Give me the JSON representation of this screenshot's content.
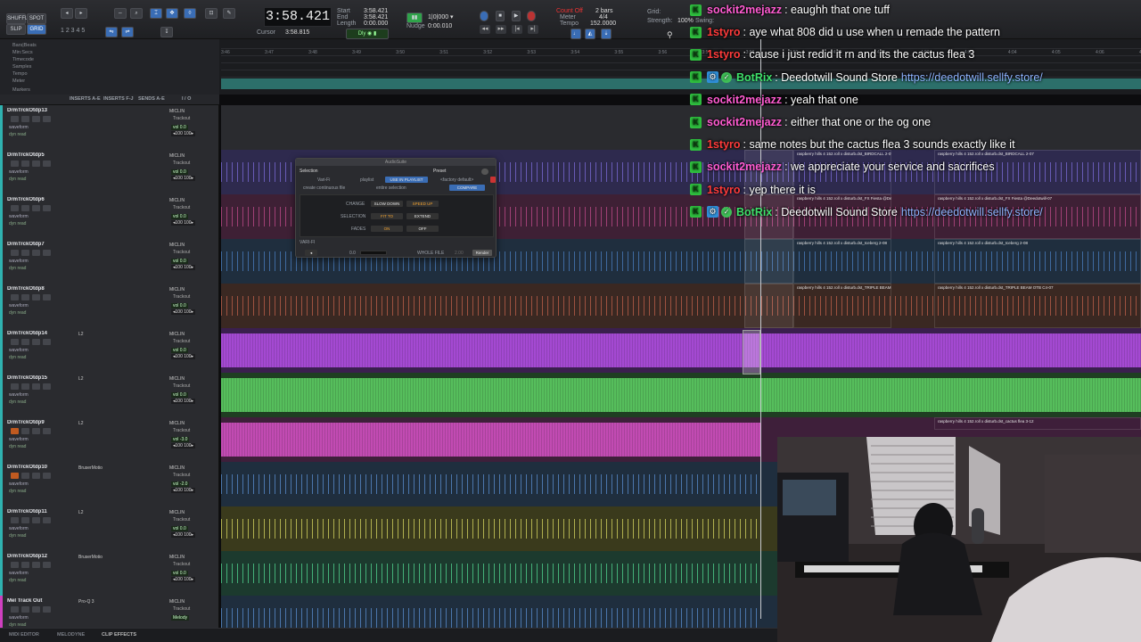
{
  "toolbar": {
    "mode_shuffle": "SHUFFLE",
    "mode_spot": "SPOT",
    "mode_slip": "SLIP",
    "mode_grid": "GRID",
    "main_counter": "3:58.421",
    "start_label": "Start",
    "end_label": "End",
    "length_label": "Length",
    "start_value": "3:58.421",
    "end_value": "3:58.421",
    "length_value": "0:00.000",
    "cursor_label": "Cursor",
    "cursor_value": "3:58.815",
    "nudge_label": "Nudge",
    "nudge_value": "0:00.010",
    "count_off": "Count Off",
    "meter": "Meter",
    "tempo": "Tempo",
    "meter_value": "4/4",
    "count_value": "2 bars",
    "tempo_value": "152.0000",
    "grid_label": "Grid:",
    "strength_label": "Strength:",
    "strength_value": "100%",
    "swing_label": "Swing:",
    "swing_value": "0%",
    "default_label": "Default: 4/4"
  },
  "ruler": {
    "rows": [
      "Bars|Beats",
      "Min:Secs",
      "Timecode",
      "Samples",
      "Tempo",
      "Meter",
      "Markers"
    ],
    "ticks": [
      "3:46",
      "3:47",
      "3:48",
      "3:49",
      "3:50",
      "3:51",
      "3:52",
      "3:53",
      "3:54",
      "3:55",
      "3:56",
      "3:57",
      "3:58",
      "3:59",
      "4:00",
      "4:01",
      "4:02",
      "4:03",
      "4:04",
      "4:05",
      "4:06",
      "4:07"
    ]
  },
  "headers": {
    "inserts_ae": "INSERTS A-E",
    "inserts_fj": "INSERTS F-J",
    "sends_ae": "SENDS A-E",
    "io": "I / O"
  },
  "tracks": [
    {
      "name": "DrmTrckOtdp13",
      "color": "#2fb2b0",
      "lane": "#2a2b2f",
      "wave": "none",
      "io": "MICLIN",
      "insert": "",
      "vol": "vol  0.0",
      "pan": "◂100  100▸"
    },
    {
      "name": "DrmTrckOtdp5",
      "color": "#2fb2b0",
      "lane": "#2e2a4e",
      "wave": "#7b6bd8",
      "io": "MICLIN",
      "insert": "",
      "vol": "vol  0.0",
      "pan": "◂100  100▸"
    },
    {
      "name": "DrmTrckOtdp6",
      "color": "#2fb2b0",
      "lane": "#3e2035",
      "wave": "#c04a8a",
      "io": "MICLIN",
      "insert": "",
      "vol": "vol  0.0",
      "pan": "◂100  100▸"
    },
    {
      "name": "DrmTrckOtdp7",
      "color": "#2fb2b0",
      "lane": "#1f2e3e",
      "wave": "#4a7ec0",
      "io": "MICLIN",
      "insert": "",
      "vol": "vol  0.0",
      "pan": "◂100  100▸"
    },
    {
      "name": "DrmTrckOtdp8",
      "color": "#2fb2b0",
      "lane": "#3a2822",
      "wave": "#c0604a",
      "io": "MICLIN",
      "insert": "",
      "vol": "vol  0.0",
      "pan": "◂100  100▸"
    },
    {
      "name": "DrmTrckOtdp14",
      "color": "#2fb2b0",
      "lane": "#3a1f4e",
      "wave": "#b04ee0",
      "io": "MICLIN",
      "insert": "L2",
      "vol": "vol  0.0",
      "pan": "◂100  100▸"
    },
    {
      "name": "DrmTrckOtdp15",
      "color": "#2fb2b0",
      "lane": "#1f3e22",
      "wave": "#5ccc62",
      "io": "MICLIN",
      "insert": "L2",
      "vol": "vol  0.0",
      "pan": "◂100  100▸"
    },
    {
      "name": "DrmTrckOtdp9",
      "color": "#2fb2b0",
      "lane": "#3e1f3a",
      "wave": "#d050c0",
      "io": "MICLIN",
      "insert": "L2",
      "vol": "vol -3.0",
      "pan": "◂100  100▸"
    },
    {
      "name": "DrmTrckOtdp10",
      "color": "#2fb2b0",
      "lane": "#1f2e3e",
      "wave": "#5a8ed0",
      "io": "MICLIN",
      "insert": "BruserMotio",
      "vol": "vol -2.0",
      "pan": "◂100  100▸"
    },
    {
      "name": "DrmTrckOtdp11",
      "color": "#2fb2b0",
      "lane": "#3a3a1c",
      "wave": "#d8d860",
      "io": "MICLIN",
      "insert": "L2",
      "vol": "vol  0.0",
      "pan": "◂100  100▸"
    },
    {
      "name": "DrmTrckOtdp12",
      "color": "#2fb2b0",
      "lane": "#1c3a2e",
      "wave": "#52d890",
      "io": "MICLIN",
      "insert": "BruserMotio",
      "vol": "vol  0.0",
      "pan": "◂100  100▸"
    },
    {
      "name": "Mel Track Out",
      "color": "#d040c0",
      "lane": "#1f2e3e",
      "wave": "#5a8ed0",
      "io": "MICLIN",
      "insert": "Pro-Q 3",
      "vol": "Melody",
      "pan": ""
    }
  ],
  "clip_labels": {
    "raspberry_1": "raspberry hills 4 152.roll x disturb.dst_BIRDCALL 2-07",
    "raspberry_2": "raspberry hills 4 152.roll x disturb.dst_FX Fiesta @Deedotwill-07",
    "raspberry_3": "raspberry hills 4 152.roll x disturb.dst_Iceberg 2-08",
    "raspberry_4": "raspberry hills 4 152.roll x disturb.dst_TRIPLE BEAM OTB C4-07",
    "raspberry_5": "raspberry hills 4 152.roll x disturb.dst_cactus flea 3-12",
    "raspb": "raspb",
    "zero_db": "+ 0 dB"
  },
  "dialog": {
    "title": "AudioSuite",
    "selection": "Selection",
    "preset": "Preset",
    "plugin": "Vari-Fi",
    "playlist": "playlist",
    "use_in_playlist": "USE IN PLAYLIST",
    "factory_default": "<factory default>",
    "create_continuous": "create continuous file",
    "entire_selection": "entire selection",
    "compare": "COMPARE",
    "change": "CHANGE",
    "slow_down": "SLOW DOWN",
    "speed_up": "SPEED UP",
    "selection_lbl": "SELECTION",
    "fit_to": "FIT TO",
    "extend": "EXTEND",
    "fades": "FADES",
    "on": "ON",
    "off": "OFF",
    "plugin_name": "VARI-FI",
    "value": "0.0",
    "whole_file": "WHOLE FILE",
    "handle": "2.00",
    "render": "Render"
  },
  "chat": [
    {
      "user": "sockit2mejazz",
      "color": "#ff5bd1",
      "bot": false,
      "text": ": eaughh that one tuff",
      "link": ""
    },
    {
      "user": "1styro",
      "color": "#ff3b3b",
      "bot": false,
      "text": ": aye what 808 did u use when u remade the pattern",
      "link": ""
    },
    {
      "user": "1styro",
      "color": "#ff3b3b",
      "bot": false,
      "text": ": cause i just redid it rn and its the cactus flea 3",
      "link": ""
    },
    {
      "user": "BotRix",
      "color": "#3fe06a",
      "bot": true,
      "text": ": Deedotwill Sound Store",
      "link": "https://deedotwill.sellfy.store/"
    },
    {
      "user": "sockit2mejazz",
      "color": "#ff5bd1",
      "bot": false,
      "text": ": yeah that one",
      "link": ""
    },
    {
      "user": "sockit2mejazz",
      "color": "#ff5bd1",
      "bot": false,
      "text": ": either that one or the og one",
      "link": ""
    },
    {
      "user": "1styro",
      "color": "#ff3b3b",
      "bot": false,
      "text": ": same notes but the cactus flea 3 sounds exactly like it",
      "link": ""
    },
    {
      "user": "sockit2mejazz",
      "color": "#ff5bd1",
      "bot": false,
      "text": ": we appreciate your service and sacrifices",
      "link": ""
    },
    {
      "user": "1styro",
      "color": "#ff3b3b",
      "bot": false,
      "text": ": yep there it is",
      "link": ""
    },
    {
      "user": "BotRix",
      "color": "#3fe06a",
      "bot": true,
      "text": ": Deedotwill Sound Store",
      "link": "https://deedotwill.sellfy.store/"
    }
  ],
  "bottom_bar": {
    "midi_editor": "MIDI EDITOR",
    "melodyne": "MELODYNE",
    "clip_effects": "CLIP EFFECTS"
  }
}
